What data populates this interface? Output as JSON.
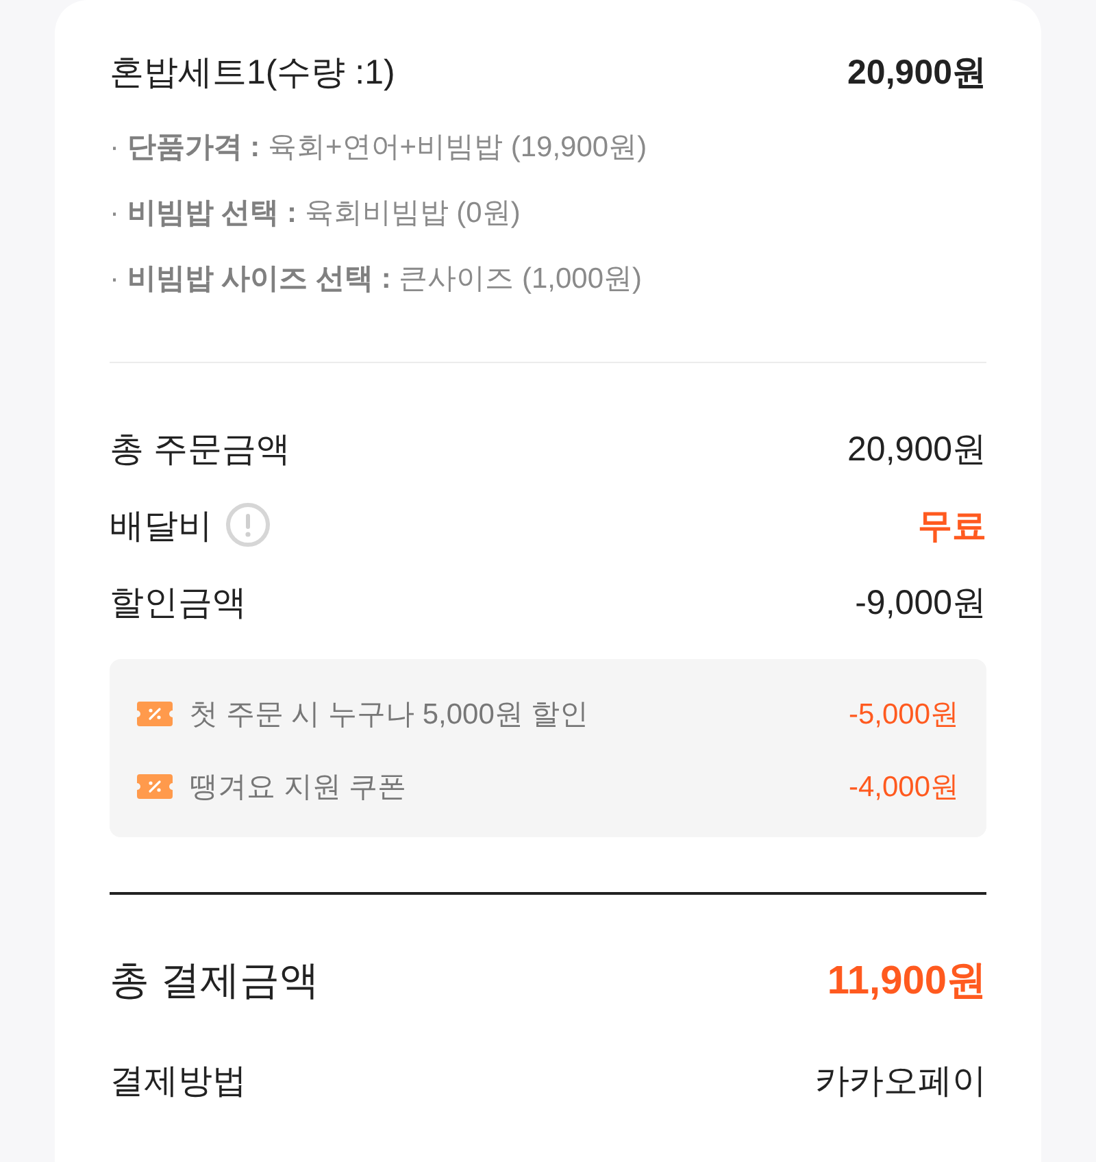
{
  "item": {
    "name": "혼밥세트1(수량 :1)",
    "price": "20,900원",
    "options": [
      {
        "text": "· **단품가격 :** 육회+연어+비빔밥 (19,900원)"
      },
      {
        "text": "· **비빔밥 선택 :** 육회비빔밥 (0원)"
      },
      {
        "text": "· **비빔밥 사이즈 선택 :** 큰사이즈 (1,000원)"
      }
    ]
  },
  "summary": [
    {
      "label": "총 주문금액",
      "value": "20,900원",
      "info": false,
      "highlighted": false
    },
    {
      "label": "배달비",
      "value": "무료",
      "info": true,
      "highlighted": true
    },
    {
      "label": "할인금액",
      "value": "-9,000원",
      "info": false,
      "highlighted": false
    }
  ],
  "discounts": [
    {
      "label": "첫 주문 시 누구나 5,000원 할인",
      "amount": "-5,000원"
    },
    {
      "label": "땡겨요 지원 쿠폰",
      "amount": "-4,000원"
    }
  ],
  "total": {
    "label": "총 결제금액",
    "value": "11,900원"
  },
  "payment": {
    "label": "결제방법",
    "value": "카카오페이"
  }
}
